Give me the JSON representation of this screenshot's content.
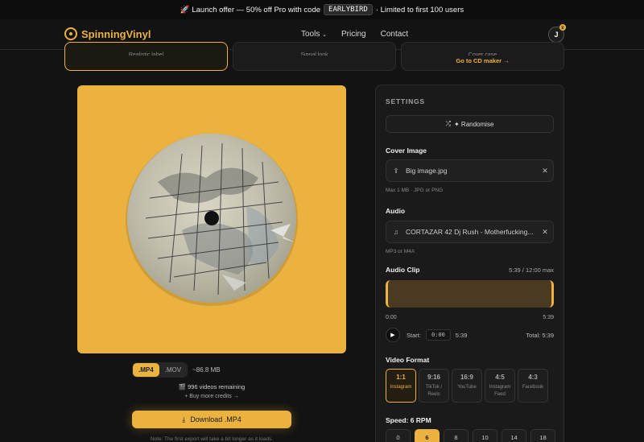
{
  "banner": {
    "prefix": "🚀 Launch offer — 50% off Pro with code",
    "code": "EARLYBIRD",
    "suffix": "· Limited to first 100 users"
  },
  "nav": {
    "brand": "SpinningVinyl",
    "links": [
      "Tools",
      "Pricing",
      "Contact"
    ],
    "avatar_initial": "J"
  },
  "top_cards": {
    "card1_faint": "Realistic label",
    "card2_faint": "Signal look",
    "card3_faint": "Cover case",
    "card3_link": "Go to CD maker →"
  },
  "export": {
    "formats": [
      ".MP4",
      ".MOV"
    ],
    "selected_format": ".MP4",
    "size": "~86.8 MB",
    "remaining": "🎬 996 videos remaining",
    "buy_more": "+ Buy more credits →",
    "download_label": "Download .MP4",
    "note": "Note: The first export will take a bit longer as it loads."
  },
  "settings": {
    "title": "SETTINGS",
    "randomise": "✦ Randomise",
    "cover_image_label": "Cover Image",
    "cover_image_file": "Big image.jpg",
    "cover_image_hint": "Max 1 MB · JPG or PNG",
    "audio_label": "Audio",
    "audio_file": "CORTAZAR 42 Dj Rush - Motherfucking...",
    "audio_hint": "MP3 or M4A",
    "clip_label": "Audio Clip",
    "clip_duration": "5:39 / 12:00 max",
    "clip_start_time": "0:00",
    "clip_end_time": "5:39",
    "start_label": "Start:",
    "start_value": "0:00",
    "start_end": "5:39",
    "total_label": "Total: 5:39",
    "video_format_label": "Video Format",
    "video_formats": [
      {
        "ratio": "1:1",
        "name": "Instagram",
        "selected": true
      },
      {
        "ratio": "9:16",
        "name": "TikTok / Reels",
        "selected": false
      },
      {
        "ratio": "16:9",
        "name": "YouTube",
        "selected": false
      },
      {
        "ratio": "4:5",
        "name": "Instagram Feed",
        "selected": false
      },
      {
        "ratio": "4:3",
        "name": "Facebook",
        "selected": false
      }
    ],
    "speed_label": "Speed: 6 RPM",
    "speeds": [
      "0",
      "6",
      "8",
      "10",
      "14",
      "18"
    ],
    "selected_speed": "6"
  },
  "colors": {
    "accent": "#ecb23f",
    "background": "#131313",
    "panel": "#1a1a1a"
  }
}
